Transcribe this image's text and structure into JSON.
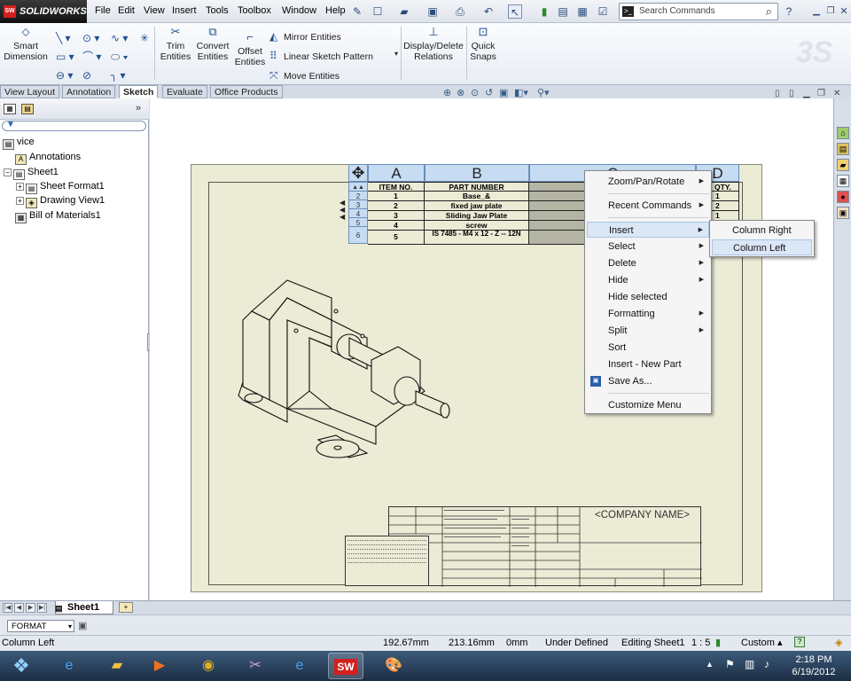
{
  "app": {
    "title": "SOLIDWORKS"
  },
  "menu": [
    "File",
    "Edit",
    "View",
    "Insert",
    "Tools",
    "Toolbox",
    "Window",
    "Help"
  ],
  "search": {
    "placeholder": "Search Commands"
  },
  "commands": {
    "smart_dimension": "Smart Dimension",
    "trim_entities": "Trim Entities",
    "convert_entities": "Convert Entities",
    "offset_entities": "Offset Entities",
    "mirror_entities": "Mirror Entities",
    "linear_sketch_pattern": "Linear Sketch Pattern",
    "move_entities": "Move Entities",
    "display_delete_relations": "Display/Delete Relations",
    "quick_snaps": "Quick Snaps"
  },
  "tabs": [
    {
      "label": "View Layout",
      "active": false
    },
    {
      "label": "Annotation",
      "active": false
    },
    {
      "label": "Sketch",
      "active": true
    },
    {
      "label": "Evaluate",
      "active": false
    },
    {
      "label": "Office Products",
      "active": false
    }
  ],
  "tree": {
    "root": "vice",
    "items": [
      "Annotations",
      "Sheet1",
      "Sheet Format1",
      "Drawing View1",
      "Bill of Materials1"
    ]
  },
  "bom": {
    "columns": [
      "A",
      "B",
      "C",
      "D"
    ],
    "rows": [
      "1",
      "2",
      "3",
      "4",
      "5",
      "6"
    ],
    "headers": [
      "ITEM NO.",
      "PART NUMBER",
      "",
      "QTY."
    ],
    "cells": [
      [
        "1",
        "Base_&",
        ""
      ],
      [
        "2",
        "fixed jaw plate",
        ""
      ],
      [
        "3",
        "Sliding Jaw Plate",
        ""
      ],
      [
        "4",
        "screw",
        ""
      ],
      [
        "5",
        "IS 7485 - M4 x 12 - Z -- 12N",
        ""
      ]
    ],
    "qty": [
      "1",
      "2",
      "1"
    ]
  },
  "title_block": {
    "company_name": "<COMPANY NAME>"
  },
  "context_menu": {
    "items": [
      {
        "label": "Zoom/Pan/Rotate",
        "submenu": true
      },
      {
        "label": "Recent Commands",
        "submenu": true
      },
      {
        "label": "Insert",
        "submenu": true,
        "highlighted": true
      },
      {
        "label": "Select",
        "submenu": true
      },
      {
        "label": "Delete",
        "submenu": true
      },
      {
        "label": "Hide",
        "submenu": true
      },
      {
        "label": "Hide selected",
        "submenu": false
      },
      {
        "label": "Formatting",
        "submenu": true
      },
      {
        "label": "Split",
        "submenu": true
      },
      {
        "label": "Sort",
        "submenu": false
      },
      {
        "label": "Insert - New Part",
        "submenu": false
      },
      {
        "label": "Save As...",
        "submenu": false
      },
      {
        "label": "Customize Menu",
        "submenu": false
      }
    ],
    "submenu": [
      "Column Right",
      "Column Left"
    ]
  },
  "sheet_tab": "Sheet1",
  "format_select": "FORMAT",
  "status": {
    "message": "Column Left",
    "x": "192.67mm",
    "y": "213.16mm",
    "z": "0mm",
    "state": "Under Defined",
    "editing": "Editing Sheet1",
    "scale": "1 : 5",
    "units": "Custom"
  },
  "clock": {
    "time": "2:18 PM",
    "date": "6/19/2012"
  }
}
